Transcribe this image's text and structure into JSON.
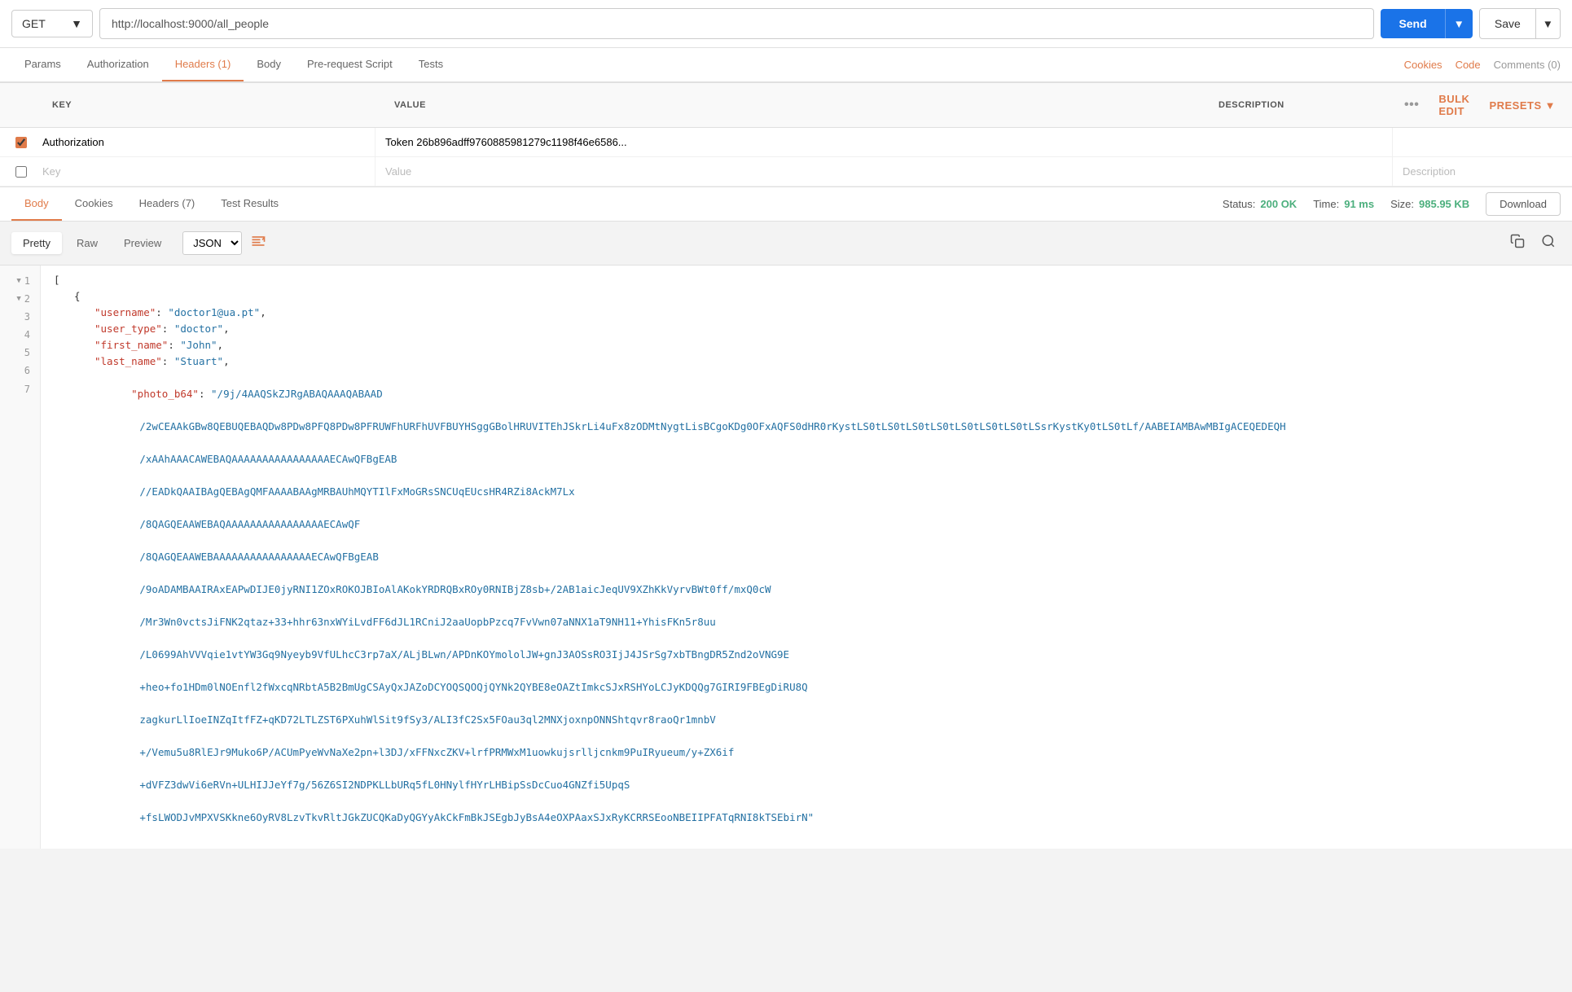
{
  "toolbar": {
    "method": "GET",
    "url": "http://localhost:9000/all_people",
    "send_label": "Send",
    "save_label": "Save"
  },
  "request_tabs": {
    "tabs": [
      {
        "id": "params",
        "label": "Params",
        "active": false
      },
      {
        "id": "authorization",
        "label": "Authorization",
        "active": false
      },
      {
        "id": "headers",
        "label": "Headers (1)",
        "active": true
      },
      {
        "id": "body",
        "label": "Body",
        "active": false
      },
      {
        "id": "prerequest",
        "label": "Pre-request Script",
        "active": false
      },
      {
        "id": "tests",
        "label": "Tests",
        "active": false
      }
    ],
    "right_links": [
      {
        "id": "cookies",
        "label": "Cookies",
        "muted": false
      },
      {
        "id": "code",
        "label": "Code",
        "muted": false
      },
      {
        "id": "comments",
        "label": "Comments (0)",
        "muted": true
      }
    ]
  },
  "headers_table": {
    "columns": {
      "key": "KEY",
      "value": "VALUE",
      "description": "DESCRIPTION"
    },
    "bulk_edit": "Bulk Edit",
    "presets": "Presets",
    "rows": [
      {
        "checked": true,
        "key": "Authorization",
        "value": "Token 26b896adff9760885981279c1198f46e6586...",
        "description": ""
      }
    ],
    "empty_row": {
      "key_placeholder": "Key",
      "value_placeholder": "Value",
      "description_placeholder": "Description"
    }
  },
  "response": {
    "tabs": [
      {
        "id": "body",
        "label": "Body",
        "active": true
      },
      {
        "id": "cookies",
        "label": "Cookies",
        "active": false
      },
      {
        "id": "headers",
        "label": "Headers (7)",
        "active": false
      },
      {
        "id": "test_results",
        "label": "Test Results",
        "active": false
      }
    ],
    "status_label": "Status:",
    "status_value": "200 OK",
    "time_label": "Time:",
    "time_value": "91 ms",
    "size_label": "Size:",
    "size_value": "985.95 KB",
    "download_label": "Download"
  },
  "response_view": {
    "tabs": [
      {
        "id": "pretty",
        "label": "Pretty",
        "active": true
      },
      {
        "id": "raw",
        "label": "Raw",
        "active": false
      },
      {
        "id": "preview",
        "label": "Preview",
        "active": false
      }
    ],
    "format": "JSON"
  },
  "code_lines": [
    {
      "num": "1",
      "fold": true,
      "content": "[",
      "type": "bracket"
    },
    {
      "num": "2",
      "fold": true,
      "content": "    {",
      "type": "bracket"
    },
    {
      "num": "3",
      "fold": false,
      "content": "        \"username\": \"doctor1@ua.pt\",",
      "parts": [
        {
          "type": "key",
          "text": "\"username\""
        },
        {
          "type": "plain",
          "text": ": "
        },
        {
          "type": "string",
          "text": "\"doctor1@ua.pt\""
        },
        {
          "type": "plain",
          "text": ","
        }
      ]
    },
    {
      "num": "4",
      "fold": false,
      "content": "        \"user_type\": \"doctor\",",
      "parts": [
        {
          "type": "key",
          "text": "\"user_type\""
        },
        {
          "type": "plain",
          "text": ": "
        },
        {
          "type": "string",
          "text": "\"doctor\""
        },
        {
          "type": "plain",
          "text": ","
        }
      ]
    },
    {
      "num": "5",
      "fold": false,
      "content": "        \"first_name\": \"John\",",
      "parts": [
        {
          "type": "key",
          "text": "\"first_name\""
        },
        {
          "type": "plain",
          "text": ": "
        },
        {
          "type": "string",
          "text": "\"John\""
        },
        {
          "type": "plain",
          "text": ","
        }
      ]
    },
    {
      "num": "6",
      "fold": false,
      "content": "        \"last_name\": \"Stuart\",",
      "parts": [
        {
          "type": "key",
          "text": "\"last_name\""
        },
        {
          "type": "plain",
          "text": ": "
        },
        {
          "type": "string",
          "text": "\"Stuart\""
        },
        {
          "type": "plain",
          "text": ","
        }
      ]
    },
    {
      "num": "7",
      "fold": false,
      "content": "        \"photo_b64\": \"/9j/4AAQSkZJRgABAQAAAQABAAD/2wCEAAkGBw8QEBUQEBAQDw8PDw8PFQ8PDw8PFRUWFhURFhUVFBUYHSggGBolHRUVITEhJSkrLi4uFx8zODMtNygtLisBCgoKDg0OFxAQFS0d...\"",
      "long": true
    }
  ],
  "long_string_lines": [
    "/9j/4AAQSkZJRgABAQAAAQABAAD",
    "/2wCEAAkGBw8QEBUQEBAQDw8PDw8PFQ8PDw8PFRUWFhURFhUVFBUYHSggGBolHRUVITEhJSkrLi4uFx8zODMtNygtLisBCgoKDg0OFxAQFS0dHR0rKystLS0tLS0tLS0tLS0tLS0tLS0tLS0tLSsrKystKy0tLS0tLf/AABEIAMBAwMBIgACEQEDEQH",
    "/xAAhAAACAWEBAQAAAAAAAAAAAAAAAAECAwQFBgEAB",
    "//EADkQAAIBAgQEBAgQMFAAAABAAgMRBAUhMQYTIlFxMoGRsSNCUqEUcsHR4RZi8AckM7Lx",
    "/8QAGQEAAWEBAQAAAAAAAAAAAAAAAAECAwQF",
    "/8QAGQEAAWEBAAAAAAAAAAAAAAAAECAwQFBgEAB",
    "/9oADAMBAAIRAxEAPwDIJE0jyRNI1ZOxROKOJBIoAlAKokYRDRQBxROy0RNIBjZ8sb+/2AB1aicJeqUV9XZhKkVyrvBWt0ff/mxQ0cW",
    "/Mr3Wn0vctsJiFNK2qtaz+33+hhr63nxWYiLvdFF6dJL1RCniJ2aaUopbPzcq7FvVwn07aNNX1aT9NH11+YhisFKn5r8uu",
    "/L0699AhVVVqie1vtYW3Gq9Nyeyb9VfULhcC3rp7aX/ALjBLwn/APDnKOYmololJW+gnJ3AOSsRO3IjJ4JSrSg7xbTBngDR5Znd2oVNG9E",
    "+heo+fo1HDm0lNOEnfl2fWxcqNRbtA5B2BmUgCSAyQxJAZoDCYOQSQOQjQYNk2QYBE8eOAZtImkcSJxRSHYoLCJyKDQQg7GIRI9FBEgDiRU8Q",
    "zagkurLlIoeINZqItfFZ+qKD72LTLZST6PXuhWlSit9fSy3/ALI3fC2Sx5FOau3ql2MNXjoxnpONNShtqvr8raoQr1mnbV",
    "+/Vemu5u8RlEJr9Muko6P/ACUmPyeWvNaXe2pn+l3DJ/xFFNxcZKV+lrfPRMWxM1uowkujsrlljcnkm9PuIRyueum/y+ZX6if",
    "+dVFZ3dwVi6eRVn+ULHIJJeYf7g/56Z6SI2NDPKLLbURq5fL0HNylfHYrLHBipSsDcCuo4GNZfi5UpqS",
    "+fsLWODJvMPXVSKkne6OyRV8LzvTkvRltJGkZUCQKaDyQGYyAkCkFmBkJSEgbJyBsA4eOXPAaxSJxRyKCRRSEooNBEIIPFATqRNI8kTSEbirN"
  ]
}
